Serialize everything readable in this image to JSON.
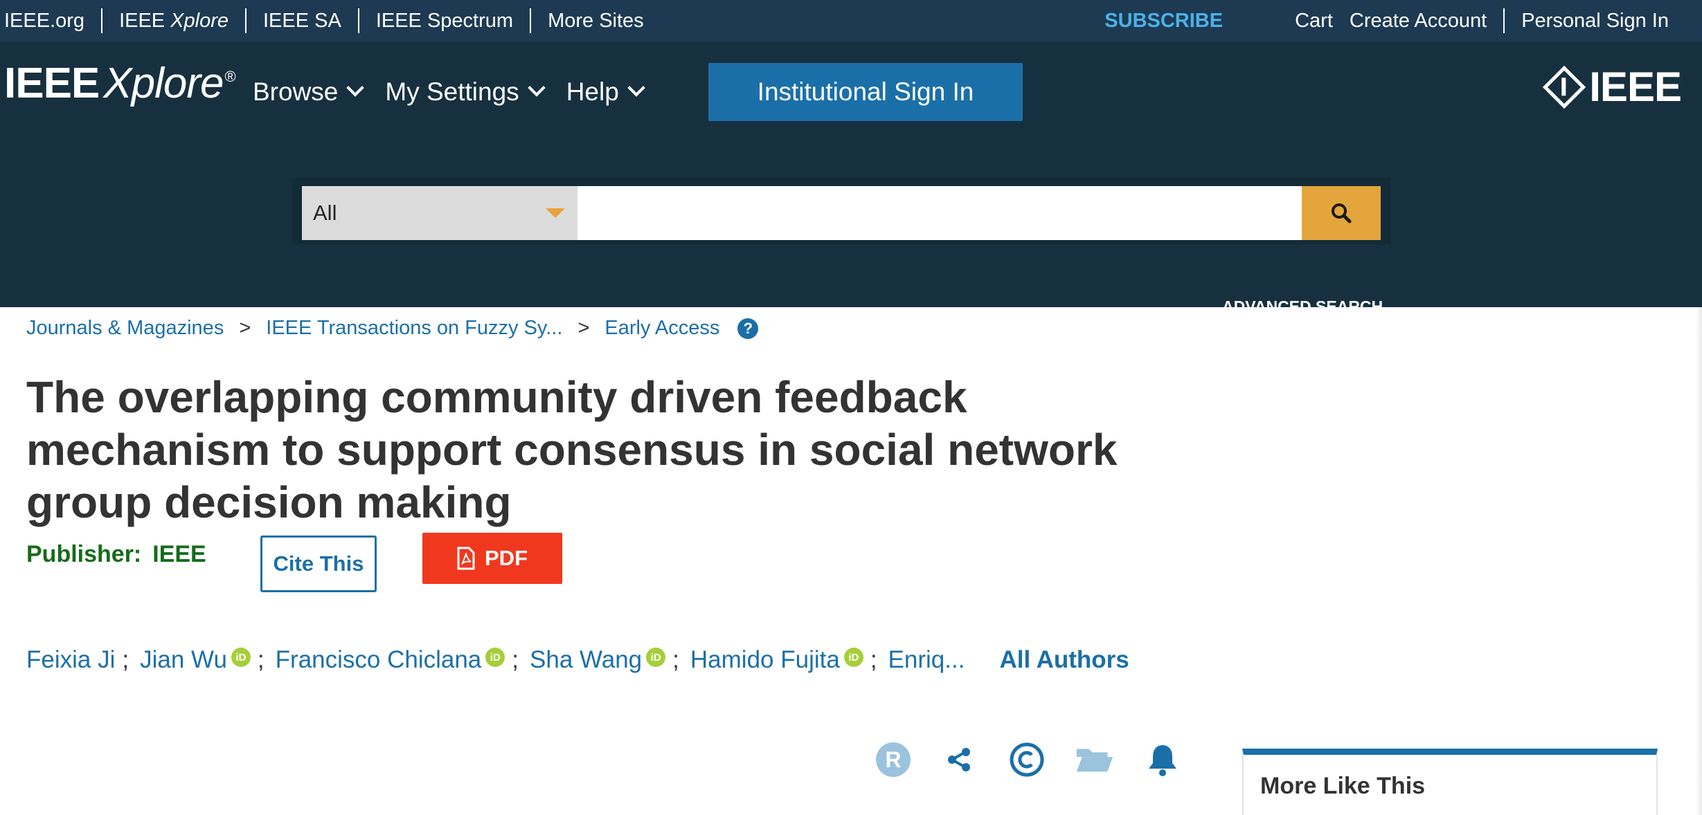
{
  "topbar": {
    "links": {
      "ieee_org": "IEEE.org",
      "ieee_xplore_prefix": "IEEE",
      "ieee_xplore_suffix": "Xplore",
      "ieee_sa": "IEEE SA",
      "ieee_spectrum": "IEEE Spectrum",
      "more_sites": "More Sites"
    },
    "subscribe": "SUBSCRIBE",
    "cart": "Cart",
    "create_account": "Create Account",
    "personal_sign_in": "Personal Sign In"
  },
  "header": {
    "logo_ieee": "IEEE",
    "logo_xplore": "Xplore",
    "logo_reg": "®",
    "nav": {
      "browse": "Browse",
      "my_settings": "My Settings",
      "help": "Help"
    },
    "institutional_sign_in": "Institutional Sign In",
    "brand_mark": "IEEE"
  },
  "search": {
    "scope_value": "All",
    "query": "",
    "placeholder": "",
    "advanced_search": "ADVANCED SEARCH"
  },
  "breadcrumb": {
    "items": [
      "Journals & Magazines",
      "IEEE Transactions on Fuzzy Sy...",
      "Early Access"
    ],
    "separator": ">"
  },
  "article": {
    "title": "The overlapping community driven feedback mechanism to support consensus in social network group decision making",
    "publisher_label": "Publisher:",
    "publisher_value": "IEEE",
    "cite_label": "Cite This",
    "pdf_label": "PDF"
  },
  "authors": {
    "list": [
      "Feixia Ji",
      "Jian Wu",
      "Francisco Chiclana",
      "Sha Wang",
      "Hamido Fujita",
      "Enriq..."
    ],
    "orcid_badge": "iD",
    "separator": ";",
    "all_authors": "All Authors"
  },
  "actions": {
    "rights_letter": "R"
  },
  "sidebar": {
    "more_like_this": "More Like This"
  },
  "colors": {
    "topbar_bg": "#1d3a52",
    "header_bg": "#17303f",
    "link_blue": "#1b6fa8",
    "subscribe_blue": "#4cb1e8",
    "search_button": "#e4a53c",
    "pdf_red": "#f0381f",
    "publisher_green": "#156b1a",
    "orcid_green": "#a6ce39"
  },
  "icons": {
    "search": "search-icon",
    "dropdown": "dropdown-triangle-icon",
    "help": "question-circle-icon",
    "pdf": "pdf-file-icon",
    "share": "share-icon",
    "copyright": "copyright-icon",
    "folder": "folder-icon",
    "alert": "bell-icon"
  }
}
